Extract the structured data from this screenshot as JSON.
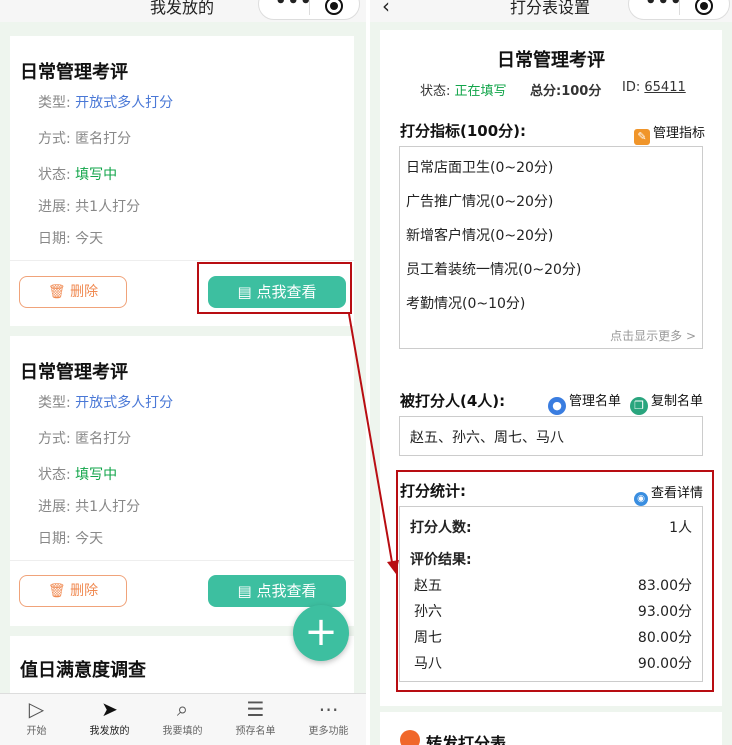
{
  "left": {
    "header_title": "我发放的",
    "capsule": {
      "more_icon": "more-dots-icon",
      "close_icon": "target-icon"
    },
    "cards": [
      {
        "title": "日常管理考评",
        "type_label": "类型:",
        "type_value": "开放式多人打分",
        "mode_label": "方式:",
        "mode_value": "匿名打分",
        "status_label": "状态:",
        "status_value": "填写中",
        "progress_label": "进展:",
        "progress_value": "共1人打分",
        "date_label": "日期:",
        "date_value": "今天",
        "delete_label": "删除",
        "view_label": "点我查看"
      },
      {
        "title": "日常管理考评",
        "type_label": "类型:",
        "type_value": "开放式多人打分",
        "mode_label": "方式:",
        "mode_value": "匿名打分",
        "status_label": "状态:",
        "status_value": "填写中",
        "progress_label": "进展:",
        "progress_value": "共1人打分",
        "date_label": "日期:",
        "date_value": "今天",
        "delete_label": "删除",
        "view_label": "点我查看"
      },
      {
        "title": "值日满意度调查"
      }
    ],
    "tabs": [
      {
        "label": "开始",
        "icon": "play-circle-icon"
      },
      {
        "label": "我发放的",
        "icon": "send-icon"
      },
      {
        "label": "我要填的",
        "icon": "search-icon"
      },
      {
        "label": "预存名单",
        "icon": "list-icon"
      },
      {
        "label": "更多功能",
        "icon": "more-circle-icon"
      }
    ]
  },
  "right": {
    "header_title": "打分表设置",
    "back_icon": "chevron-left-icon",
    "title": "日常管理考评",
    "status_label": "状态:",
    "status_value": "正在填写",
    "total_label": "总分:",
    "total_value": "100分",
    "id_label": "ID:",
    "id_value": "65411",
    "indicators_label": "打分指标(100分):",
    "manage_indicators": "管理指标",
    "indicators": [
      "日常店面卫生(0~20分)",
      "广告推广情况(0~20分)",
      "新增客户情况(0~20分)",
      "员工着装统一情况(0~20分)",
      "考勤情况(0~10分)"
    ],
    "show_more": "点击显示更多 >",
    "rated_label": "被打分人(4人):",
    "manage_list": "管理名单",
    "copy_list": "复制名单",
    "rated_people": "赵五、孙六、周七、马八",
    "stats_label": "打分统计:",
    "view_details": "查看详情",
    "count_label": "打分人数:",
    "count_value": "1人",
    "result_label": "评价结果:",
    "results": [
      {
        "name": "赵五",
        "score": "83.00分"
      },
      {
        "name": "孙六",
        "score": "93.00分"
      },
      {
        "name": "周七",
        "score": "80.00分"
      },
      {
        "name": "马八",
        "score": "90.00分"
      }
    ],
    "footer_text": "转发打分表"
  },
  "colors": {
    "accent": "#3dbfa0",
    "highlight": "#b80d12",
    "delete": "#f08a52",
    "link": "#4a78d6",
    "ok": "#12a54a"
  }
}
